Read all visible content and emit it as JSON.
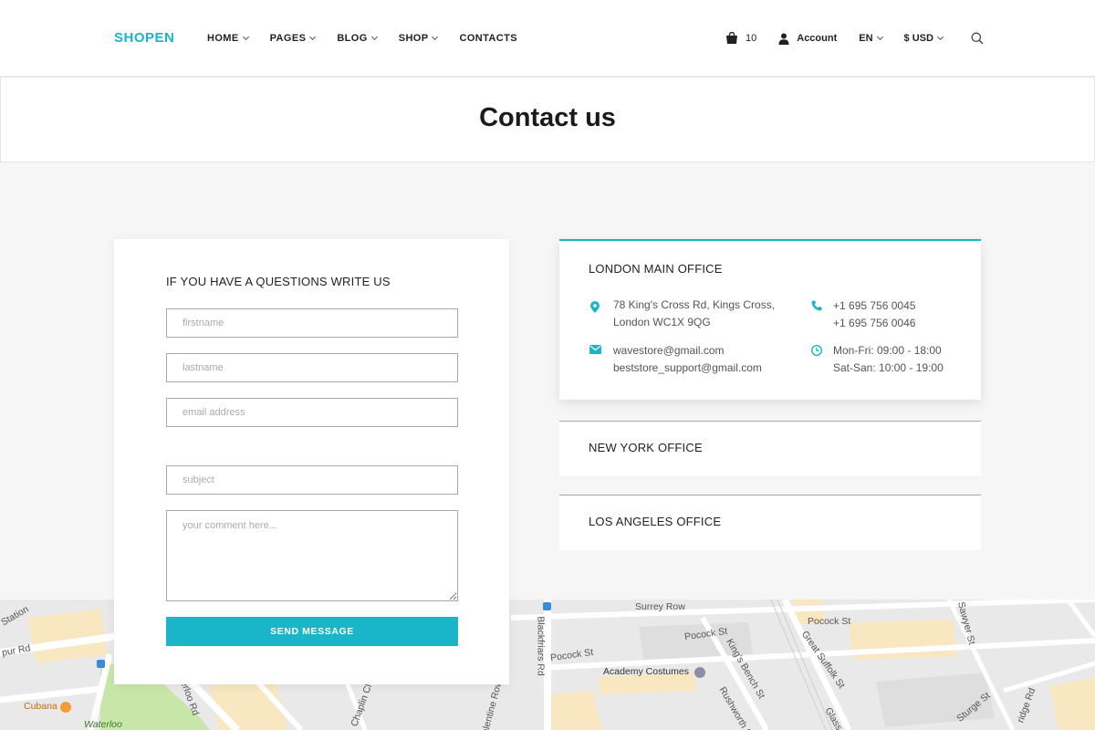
{
  "header": {
    "logo": "SHOPEN",
    "nav": [
      {
        "label": "HOME",
        "dropdown": true
      },
      {
        "label": "PAGES",
        "dropdown": true
      },
      {
        "label": "BLOG",
        "dropdown": true
      },
      {
        "label": "SHOP",
        "dropdown": true
      },
      {
        "label": "CONTACTS",
        "dropdown": false
      }
    ],
    "cart_count": "10",
    "account_label": "Account",
    "language": "EN",
    "currency": "$ USD"
  },
  "page_title": "Contact us",
  "form": {
    "heading": "IF YOU HAVE A QUESTIONS WRITE US",
    "firstname_placeholder": "firstname",
    "lastname_placeholder": "lastname",
    "email_placeholder": "email address",
    "subject_placeholder": "subject",
    "comment_placeholder": "your comment here...",
    "submit_label": "SEND MESSAGE"
  },
  "offices": {
    "london": {
      "title": "LONDON MAIN OFFICE",
      "address_line1": "78 King's Cross Rd, Kings Cross,",
      "address_line2": "London WC1X 9QG",
      "email1": "wavestore@gmail.com",
      "email2": "beststore_support@gmail.com",
      "phone1": "+1 695 756 0045",
      "phone2": "+1 695 756 0046",
      "hours1": "Mon-Fri: 09:00 - 18:00",
      "hours2": "Sat-San: 10:00 - 19:00"
    },
    "new_york": {
      "title": "NEW YORK OFFICE"
    },
    "los_angeles": {
      "title": "LOS ANGELES OFFICE"
    }
  },
  "map": {
    "labels": [
      "Surrey Row",
      "Pocock St",
      "Pocock St",
      "Pocock St",
      "Academy Costumes",
      "Blackfriars Rd",
      "King's Bench St",
      "Great Suffolk St",
      "Sawyer St",
      "Chaplin Cl",
      "Valentine Row",
      "Rushworth St",
      "Sturge St",
      "Cubana",
      "Waterloo",
      "Station",
      "pur Rd",
      "erloo Rd",
      "Glass",
      "ridge Rd"
    ]
  },
  "colors": {
    "accent": "#1ab5c8"
  }
}
